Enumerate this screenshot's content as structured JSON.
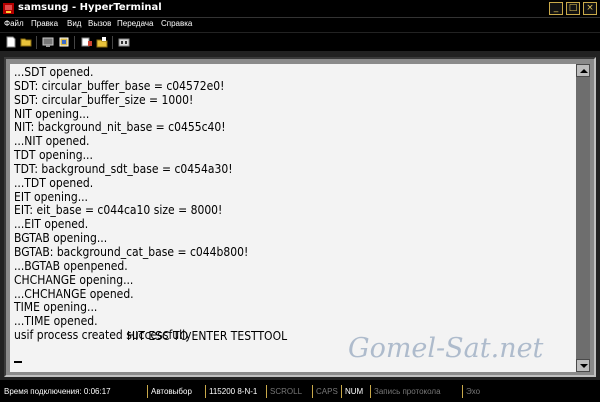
{
  "window": {
    "title": "samsung - HyperTerminal",
    "minimize_glyph": "_",
    "maximize_glyph": "□",
    "close_glyph": "×"
  },
  "menu": [
    "Файл",
    "Правка",
    "Вид",
    "Вызов",
    "Передача",
    "Справка"
  ],
  "toolbar": {
    "buttons": [
      "new-icon",
      "open-icon",
      "disconnect-icon",
      "dial-icon",
      "send-icon",
      "receive-icon",
      "properties-icon"
    ]
  },
  "terminal": {
    "lines": [
      "...SDT opened.",
      "SDT: circular_buffer_base = c04572e0!",
      "SDT: circular_buffer_size = 1000!",
      "NIT opening...",
      "NIT: background_nit_base = c0455c40!",
      "...NIT opened.",
      "TDT opening...",
      "TDT: background_sdt_base = c0454a30!",
      "...TDT opened.",
      "EIT opening...",
      "EIT: eit_base = c044ca10 size = 8000!",
      "...EIT opened.",
      "BGTAB opening...",
      "BGTAB: background_cat_base = c044b800!",
      "...BGTAB openpened.",
      "CHCHANGE opening...",
      "...CHCHANGE opened.",
      "TIME opening...",
      "...TIME opened.",
      "usif process created successfully"
    ],
    "prompt": "HIT ESC TO ENTER TESTTOOL",
    "watermark": "Gomel-Sat.net",
    "background_color": "#f3f3f3",
    "text_color": "#000000"
  },
  "status": {
    "connected_time": "Время подключения: 0:06:17",
    "detect": "Автовыбор",
    "port_settings": "115200 8-N-1",
    "scroll": "SCROLL",
    "caps": "CAPS",
    "num": "NUM",
    "capture": "Запись протокола",
    "echo": "Эхо"
  },
  "colors": {
    "accent": "#c9a94a",
    "chrome": "#000000"
  }
}
